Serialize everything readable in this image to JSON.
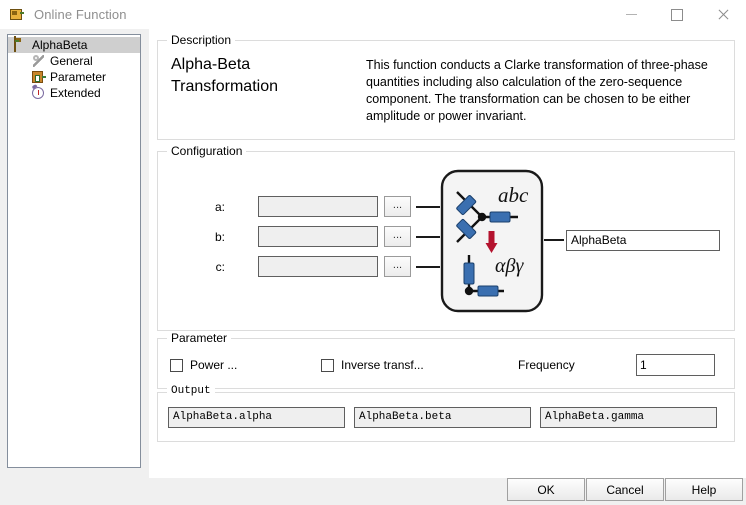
{
  "window": {
    "title": "Online Function",
    "icon": "function-module-icon",
    "controls": {
      "minimize": "minimize-icon",
      "maximize": "maximize-icon",
      "close": "close-icon"
    }
  },
  "tree": {
    "items": [
      {
        "label": "AlphaBeta",
        "icon": "function-module-icon",
        "selected": true,
        "level": 0
      },
      {
        "label": "General",
        "icon": "wrench-icon",
        "selected": false,
        "level": 1
      },
      {
        "label": "Parameter",
        "icon": "parameter-icon",
        "selected": false,
        "level": 1
      },
      {
        "label": "Extended",
        "icon": "clock-icon",
        "selected": false,
        "level": 1
      }
    ]
  },
  "description": {
    "group_title": "Description",
    "title": "Alpha-Beta\nTransformation",
    "title_line1": "Alpha-Beta",
    "title_line2": "Transformation",
    "body": "This function conducts a Clarke transformation of three-phase quantities including also calculation of the zero-sequence component. The transformation can be chosen to be either amplitude or power invariant."
  },
  "configuration": {
    "group_title": "Configuration",
    "inputs": [
      {
        "label": "a:",
        "value": "",
        "browse_label": "...",
        "enabled": false
      },
      {
        "label": "b:",
        "value": "",
        "browse_label": "...",
        "enabled": false
      },
      {
        "label": "c:",
        "value": "",
        "browse_label": "...",
        "enabled": false
      }
    ],
    "diagram": {
      "top_label": "abc",
      "bottom_label": "αβγ",
      "arrow_color": "#b4132e",
      "winding_color": "#3a6fb0"
    },
    "output_value": "AlphaBeta"
  },
  "parameter": {
    "group_title": "Parameter",
    "checkboxes": [
      {
        "label": "Power ...",
        "checked": false
      },
      {
        "label": "Inverse transf...",
        "checked": false
      }
    ],
    "frequency_label": "Frequency",
    "frequency_value": "1"
  },
  "output": {
    "group_title": "Output",
    "fields": [
      "AlphaBeta.alpha",
      "AlphaBeta.beta",
      "AlphaBeta.gamma"
    ]
  },
  "footer": {
    "ok": "OK",
    "cancel": "Cancel",
    "help": "Help"
  }
}
